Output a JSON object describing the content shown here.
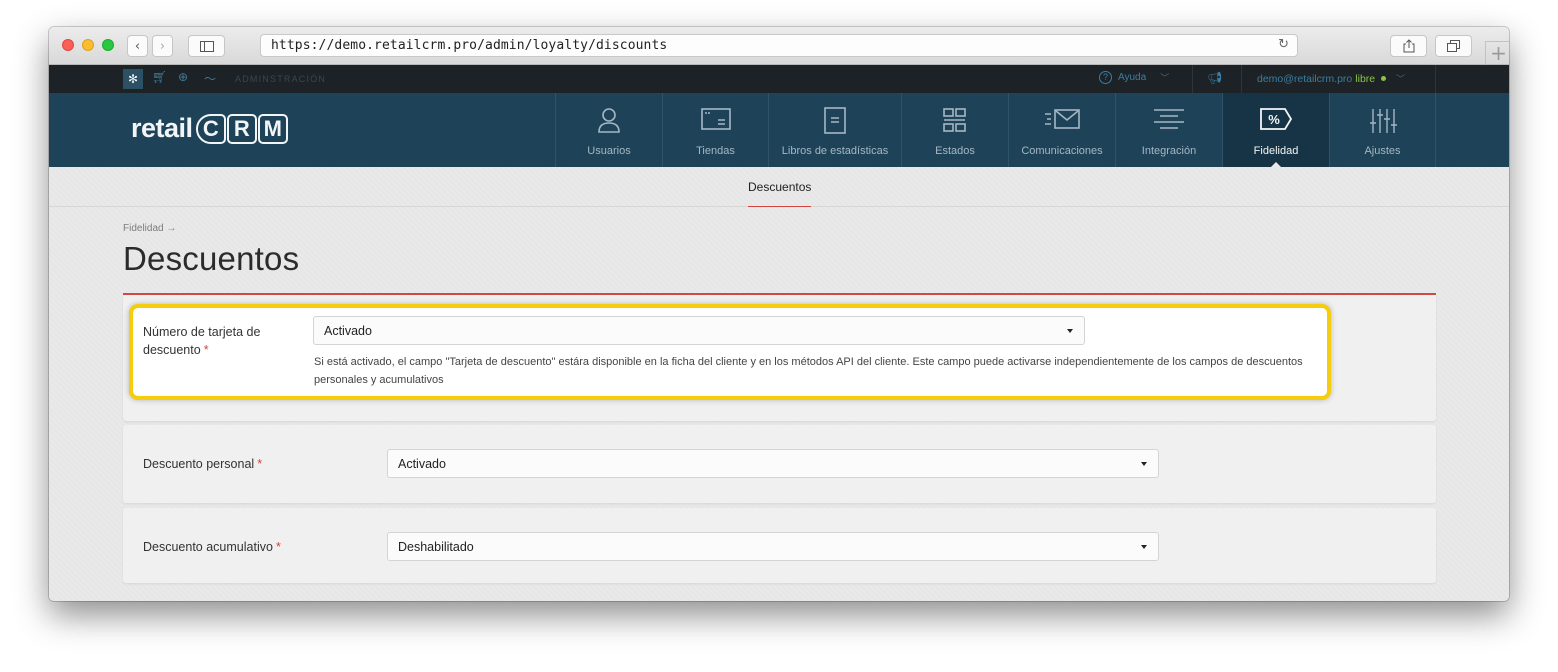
{
  "browser": {
    "url": "https://demo.retailcrm.pro/admin/loyalty/discounts",
    "back_icon": "chevron-left-icon",
    "forward_icon": "chevron-right-icon",
    "sidebar_icon": "sidebar-icon",
    "reload_icon": "reload-icon",
    "share_icon": "share-icon",
    "tabs_icon": "tabs-icon",
    "new_tab": "+"
  },
  "topbar": {
    "section": "ADMINSTRACIÓN",
    "help": "Ayuda",
    "user_email": "demo@retailcrm.pro",
    "user_plan": "libre"
  },
  "logo": {
    "prefix": "retail",
    "letters": [
      "C",
      "R",
      "M"
    ]
  },
  "nav": {
    "items": [
      {
        "label": "Usuarios",
        "icon": "user-icon"
      },
      {
        "label": "Tiendas",
        "icon": "store-icon"
      },
      {
        "label": "Libros de estadísticas",
        "icon": "book-icon"
      },
      {
        "label": "Estados",
        "icon": "statuses-icon"
      },
      {
        "label": "Comunicaciones",
        "icon": "mail-icon"
      },
      {
        "label": "Integración",
        "icon": "integration-icon"
      },
      {
        "label": "Fidelidad",
        "icon": "percent-tag-icon",
        "active": true
      },
      {
        "label": "Ajustes",
        "icon": "sliders-icon"
      }
    ]
  },
  "subnav": {
    "active_tab": "Descuentos"
  },
  "page": {
    "breadcrumb": "Fidelidad →",
    "title": "Descuentos"
  },
  "form": {
    "required_mark": "*",
    "card_number": {
      "label_line1": "Número de tarjeta de",
      "label_line2": "descuento",
      "value": "Activado",
      "hint": "Si está activado, el campo \"Tarjeta de descuento\" estára disponible en la ficha del cliente y en los métodos API del cliente. Este campo puede activarse independientemente de los campos de descuentos personales y acumulativos"
    },
    "personal": {
      "label": "Descuento personal",
      "value": "Activado"
    },
    "cumulative": {
      "label": "Descuento acumulativo",
      "value": "Deshabilitado"
    }
  },
  "colors": {
    "nav_bg": "#1e4257",
    "nav_active_bg": "#163446",
    "topbar_bg": "#1d2226",
    "accent_red": "#d0453f",
    "highlight_yellow": "#f6cc0f",
    "link_blue": "#3b7ea1",
    "status_green": "#8bc34a"
  }
}
